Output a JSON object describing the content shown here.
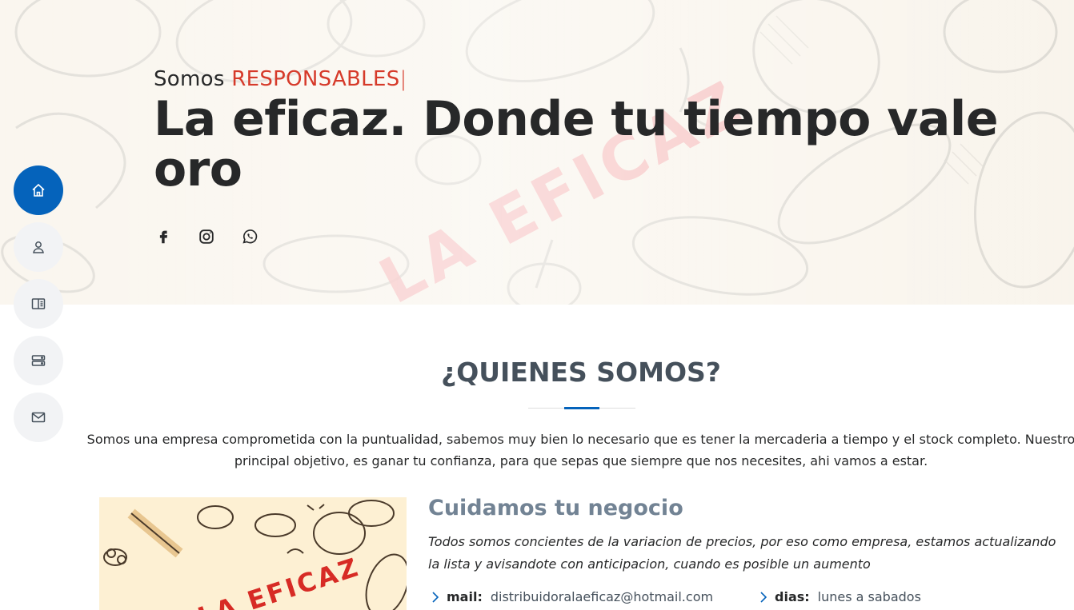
{
  "hero": {
    "subtitle_prefix": "Somos",
    "subtitle_highlight": "RESPONSABLES",
    "caret": "|",
    "title": "La eficaz. Donde tu tiempo vale oro",
    "watermark": "LA EFICAZ",
    "social": [
      "facebook-icon",
      "instagram-icon",
      "whatsapp-icon"
    ]
  },
  "nav": {
    "items": [
      {
        "icon": "home-icon",
        "active": true
      },
      {
        "icon": "person-icon",
        "active": false
      },
      {
        "icon": "file-rich-text-icon",
        "active": false
      },
      {
        "icon": "server-icon",
        "active": false
      },
      {
        "icon": "envelope-icon",
        "active": false
      }
    ]
  },
  "about": {
    "title": "¿QUIENES SOMOS?",
    "intro": "Somos una empresa comprometida con la puntualidad, sabemos muy bien lo necesario que es tener la mercaderia a tiempo y el stock completo. Nuestro principal objetivo, es ganar tu confianza, para que sepas que siempre que nos necesites, ahi vamos a estar.",
    "image_text": "LA EFICAZ",
    "heading": "Cuidamos tu negocio",
    "description": "Todos somos concientes de la variacion de precios, por eso como empresa, estamos actualizando la lista y avisandote con anticipacion, cuando es posible un aumento",
    "info": [
      {
        "label": "mail:",
        "value": "distribuidoralaeficaz@hotmail.com"
      },
      {
        "label": "dias:",
        "value": "lunes a sabados"
      }
    ]
  },
  "colors": {
    "accent": "#0563bb",
    "highlight": "#d63a2a",
    "heading": "#45505b",
    "subheading": "#728394"
  }
}
